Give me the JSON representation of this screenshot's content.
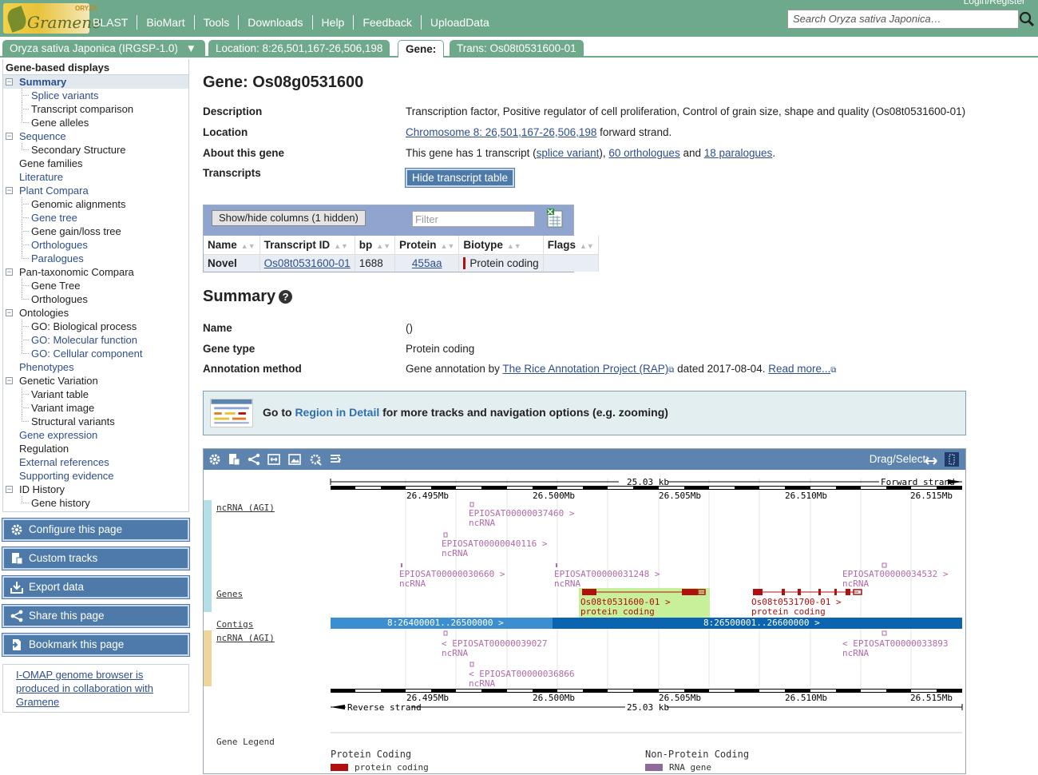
{
  "header": {
    "logo_text": "Gramene",
    "logo_sup": "ORYZA",
    "nav": [
      "BLAST",
      "BioMart",
      "Tools",
      "Downloads",
      "Help",
      "Feedback",
      "UploadData"
    ],
    "login": "Login/Register",
    "search_placeholder": "Search Oryza sativa Japonica…"
  },
  "tabs": {
    "species": "Oryza sativa Japonica (IRGSP-1.0)",
    "species_arrow": "▼",
    "location": "Location: 8:26,501,167-26,506,198",
    "gene": "Gene:",
    "trans": "Trans: Os08t0531600-01"
  },
  "sidebar": {
    "heading": "Gene-based displays",
    "items": [
      {
        "label": "Summary",
        "level": 1,
        "toggle": "−",
        "link": true,
        "selected": true
      },
      {
        "label": "Splice variants",
        "level": 2,
        "link": true
      },
      {
        "label": "Transcript comparison",
        "level": 2,
        "link": false
      },
      {
        "label": "Gene alleles",
        "level": 2,
        "link": false
      },
      {
        "label": "Sequence",
        "level": 1,
        "toggle": "−",
        "link": true
      },
      {
        "label": "Secondary Structure",
        "level": 2,
        "link": false
      },
      {
        "label": "Gene families",
        "level": 1,
        "link": false
      },
      {
        "label": "Literature",
        "level": 1,
        "link": true
      },
      {
        "label": "Plant Compara",
        "level": 1,
        "toggle": "−",
        "link": true
      },
      {
        "label": "Genomic alignments",
        "level": 2,
        "link": false
      },
      {
        "label": "Gene tree",
        "level": 2,
        "link": true
      },
      {
        "label": "Gene gain/loss tree",
        "level": 2,
        "link": false
      },
      {
        "label": "Orthologues",
        "level": 2,
        "link": true
      },
      {
        "label": "Paralogues",
        "level": 2,
        "link": true
      },
      {
        "label": "Pan-taxonomic Compara",
        "level": 1,
        "toggle": "−",
        "link": false
      },
      {
        "label": "Gene Tree",
        "level": 2,
        "link": false
      },
      {
        "label": "Orthologues",
        "level": 2,
        "link": false
      },
      {
        "label": "Ontologies",
        "level": 1,
        "toggle": "−",
        "link": false
      },
      {
        "label": "GO: Biological process",
        "level": 2,
        "link": false
      },
      {
        "label": "GO: Molecular function",
        "level": 2,
        "link": true
      },
      {
        "label": "GO: Cellular component",
        "level": 2,
        "link": true
      },
      {
        "label": "Phenotypes",
        "level": 1,
        "link": true
      },
      {
        "label": "Genetic Variation",
        "level": 1,
        "toggle": "−",
        "link": false
      },
      {
        "label": "Variant table",
        "level": 2,
        "link": false
      },
      {
        "label": "Variant image",
        "level": 2,
        "link": false
      },
      {
        "label": "Structural variants",
        "level": 2,
        "link": false
      },
      {
        "label": "Gene expression",
        "level": 1,
        "link": true
      },
      {
        "label": "Regulation",
        "level": 1,
        "link": false
      },
      {
        "label": "External references",
        "level": 1,
        "link": true
      },
      {
        "label": "Supporting evidence",
        "level": 1,
        "link": true
      },
      {
        "label": "ID History",
        "level": 1,
        "toggle": "−",
        "link": false
      },
      {
        "label": "Gene history",
        "level": 2,
        "link": false
      }
    ],
    "buttons": [
      "Configure this page",
      "Custom tracks",
      "Export data",
      "Share this page",
      "Bookmark this page"
    ],
    "note": "I-OMAP genome browser is produced in collaboration with Gramene"
  },
  "gene": {
    "title": "Gene: Os08g0531600",
    "description_label": "Description",
    "description": "Transcription factor, Positive regulator of cell proliferation, Control of grain size, shape and quality (Os08t0531600-01)",
    "location_label": "Location",
    "location_link": "Chromosome 8: 26,501,167-26,506,198",
    "location_suffix": " forward strand.",
    "about_label": "About this gene",
    "about_pre": "This gene has 1 transcript (",
    "about_splice": "splice variant",
    "about_mid1": "), ",
    "about_orth": "60 orthologues",
    "about_mid2": " and ",
    "about_para": "18 paralogues",
    "about_end": ".",
    "transcripts_label": "Transcripts",
    "hide_btn": "Hide transcript table"
  },
  "tx_table": {
    "showhide": "Show/hide columns (1 hidden)",
    "filter_placeholder": "Filter",
    "columns": [
      "Name",
      "Transcript ID",
      "bp",
      "Protein",
      "Biotype",
      "Flags"
    ],
    "row": {
      "name": "Novel",
      "id": "Os08t0531600-01",
      "bp": "1688",
      "protein": "455aa",
      "biotype": "Protein coding",
      "flags": ""
    }
  },
  "summary": {
    "title": "Summary",
    "name_label": "Name",
    "name_value": "()",
    "type_label": "Gene type",
    "type_value": "Protein coding",
    "annot_label": "Annotation method",
    "annot_pre": "Gene annotation by ",
    "annot_link": "The Rice Annotation Project (RAP)",
    "annot_mid": " dated 2017-08-04. ",
    "annot_more": "Read more..."
  },
  "region_banner": {
    "pre": "Go to ",
    "link": "Region in Detail",
    "post": " for more tracks and navigation options (e.g. zooming)"
  },
  "browser": {
    "dragselect": "Drag/Select:",
    "scale_label": "25.03 kb",
    "fwd_strand": "Forward strand",
    "rev_strand": "Reverse strand",
    "ticks": [
      "26.495Mb",
      "26.500Mb",
      "26.505Mb",
      "26.510Mb",
      "26.515Mb"
    ],
    "track_labels": {
      "ncrna_top": "ncRNA (AGI)",
      "genes": "Genes",
      "contigs": "Contigs",
      "ncrna_bottom": "ncRNA (AGI)"
    },
    "features": {
      "f1": "EPIOSAT00000037460 >",
      "f2": "EPIOSAT00000040116 >",
      "f3": "EPIOSAT00000030660 >",
      "f4": "EPIOSAT00000031248 >",
      "f5": "EPIOSAT00000034532 >",
      "ncrna": "ncRNA",
      "g1": "Os08t0531600-01 >",
      "g2": "Os08t0531700-01 >",
      "pc": "protein coding",
      "c1": "8:26400001..26500000 >",
      "c2": "8:26500001..26600000 >",
      "r1": "< EPIOSAT00000039027",
      "r2": "< EPIOSAT00000036866",
      "r3": "< EPIOSAT00000033893"
    },
    "legend": {
      "title": "Gene Legend",
      "pc_head": "Protein Coding",
      "pc_item": "protein coding",
      "npc_head": "Non-Protein Coding",
      "npc_item": "RNA gene"
    },
    "colors": {
      "toolbar": "#5d83af",
      "contig_light": "#3b8fd0",
      "contig_dark": "#0b64b0",
      "gene_red": "#b01010",
      "highlight": "#c8f09a",
      "ncrna": "#b16aa8"
    }
  }
}
